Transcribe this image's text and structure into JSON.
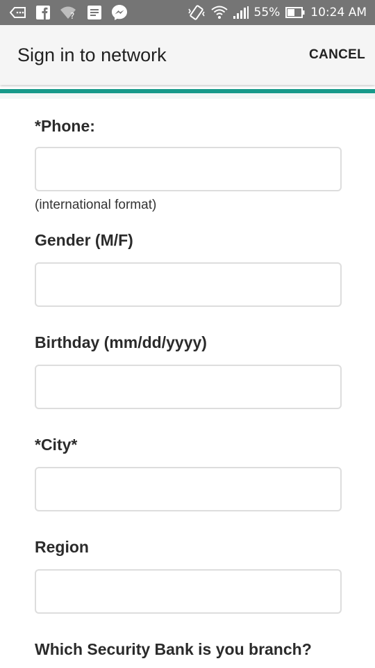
{
  "status_bar": {
    "battery_percent": "55%",
    "time": "10:24 AM",
    "icons": [
      "keyboard-back-icon",
      "facebook-icon",
      "wifi-question-icon",
      "news-icon",
      "messenger-icon",
      "vibrate-icon",
      "wifi-icon",
      "signal-icon",
      "battery-icon"
    ]
  },
  "app_bar": {
    "title": "Sign in to network",
    "cancel_label": "CANCEL"
  },
  "colors": {
    "accent": "#179a8a",
    "status_bar": "#757575",
    "app_bar": "#f5f5f5",
    "input_border": "#dddddd"
  },
  "form": {
    "phone": {
      "label": "*Phone:",
      "value": "",
      "helper": "(international format)"
    },
    "gender": {
      "label": "Gender (M/F)",
      "value": ""
    },
    "birthday": {
      "label": "Birthday (mm/dd/yyyy)",
      "value": ""
    },
    "city": {
      "label": "*City*",
      "value": ""
    },
    "region": {
      "label": "Region",
      "value": ""
    },
    "branch": {
      "label": "Which Security Bank is you branch?"
    }
  }
}
